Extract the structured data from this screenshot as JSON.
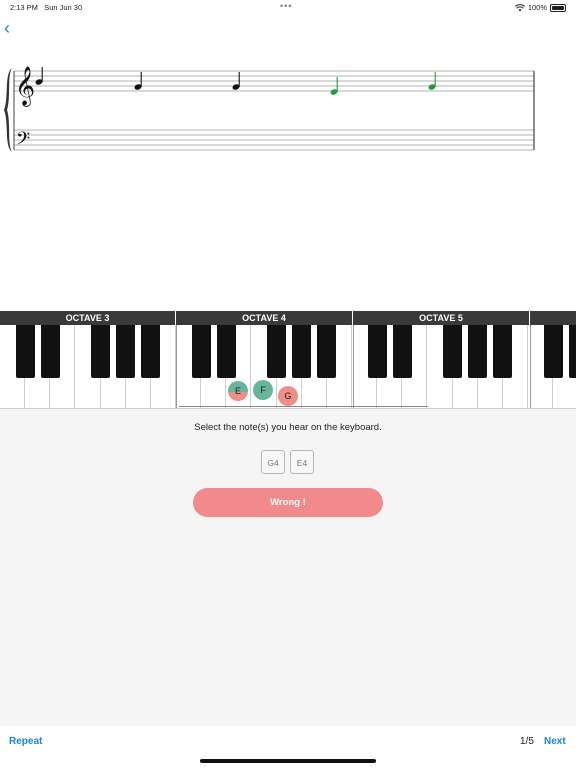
{
  "status_bar": {
    "time": "2:13 PM",
    "date": "Sun Jun 30",
    "dots": "•••",
    "battery": "100%"
  },
  "nav": {
    "back_icon": "chevron-left-icon",
    "back_glyph": "‹"
  },
  "score": {
    "clefs": [
      "treble-clef-icon",
      "bass-clef-icon"
    ],
    "notes": [
      {
        "color": "#111111"
      },
      {
        "color": "#111111"
      },
      {
        "color": "#111111"
      },
      {
        "color": "#1e9a3c"
      },
      {
        "color": "#1e9a3c"
      }
    ]
  },
  "keyboard": {
    "octaves": [
      "OCTAVE 3",
      "OCTAVE 4",
      "OCTAVE 5"
    ],
    "selected_notes": [
      {
        "label": "E",
        "state": "correct-and-wrong"
      },
      {
        "label": "F",
        "state": "correct"
      },
      {
        "label": "G",
        "state": "wrong"
      }
    ]
  },
  "exercise": {
    "instruction": "Select the note(s) you hear on the keyboard.",
    "answers": [
      "G4",
      "E4"
    ],
    "result_label": "Wrong !"
  },
  "footer": {
    "repeat_label": "Repeat",
    "progress": "1/5",
    "next_label": "Next"
  },
  "colors": {
    "accent": "#1a82d8",
    "correct": "#67b69b",
    "wrong": "#ee8e88",
    "result_button": "#f28a8c",
    "octave_bar": "#3a3a3a"
  }
}
